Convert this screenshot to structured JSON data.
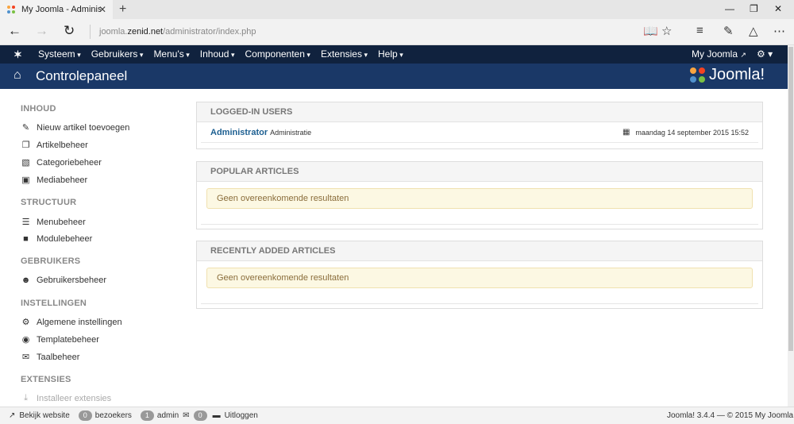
{
  "browser": {
    "tab_title": "My Joomla - Administra",
    "tab_close": "✕",
    "new_tab": "+",
    "url_prefix": "joomla.",
    "url_domain": "zenid.net",
    "url_path": "/administrator/index.php"
  },
  "topnav": {
    "items": [
      "Systeem",
      "Gebruikers",
      "Menu's",
      "Inhoud",
      "Componenten",
      "Extensies",
      "Help"
    ],
    "my_joomla": "My Joomla"
  },
  "header": {
    "title": "Controlepaneel",
    "brand": "Joomla!"
  },
  "sidebar": {
    "sections": [
      {
        "title": "INHOUD",
        "items": [
          {
            "label": "Nieuw artikel toevoegen",
            "icon": "pencil-icon"
          },
          {
            "label": "Artikelbeheer",
            "icon": "stack-icon"
          },
          {
            "label": "Categoriebeheer",
            "icon": "folder-icon"
          },
          {
            "label": "Mediabeheer",
            "icon": "image-icon"
          }
        ]
      },
      {
        "title": "STRUCTUUR",
        "items": [
          {
            "label": "Menubeheer",
            "icon": "list-icon"
          },
          {
            "label": "Modulebeheer",
            "icon": "cube-icon"
          }
        ]
      },
      {
        "title": "GEBRUIKERS",
        "items": [
          {
            "label": "Gebruikersbeheer",
            "icon": "users-icon"
          }
        ]
      },
      {
        "title": "INSTELLINGEN",
        "items": [
          {
            "label": "Algemene instellingen",
            "icon": "cog-icon"
          },
          {
            "label": "Templatebeheer",
            "icon": "eye-icon"
          },
          {
            "label": "Taalbeheer",
            "icon": "comments-icon"
          }
        ]
      },
      {
        "title": "EXTENSIES",
        "items": [
          {
            "label": "Installeer extensies",
            "icon": "download-icon"
          }
        ]
      }
    ]
  },
  "panels": {
    "logged_in": {
      "title": "LOGGED-IN USERS",
      "user": "Administrator",
      "role": "Administratie",
      "date": "maandag 14 september 2015 15:52"
    },
    "popular": {
      "title": "POPULAR ARTICLES",
      "notice": "Geen overeenkomende resultaten"
    },
    "recent": {
      "title": "RECENTLY ADDED ARTICLES",
      "notice": "Geen overeenkomende resultaten"
    }
  },
  "statusbar": {
    "view_site": "Bekijk website",
    "visitors_count": "0",
    "visitors_label": "bezoekers",
    "admin_count": "1",
    "admin_label": "admin",
    "messages_count": "0",
    "logout": "Uitloggen",
    "version": "Joomla! 3.4.4",
    "copyright": "— © 2015 My Joomla"
  }
}
